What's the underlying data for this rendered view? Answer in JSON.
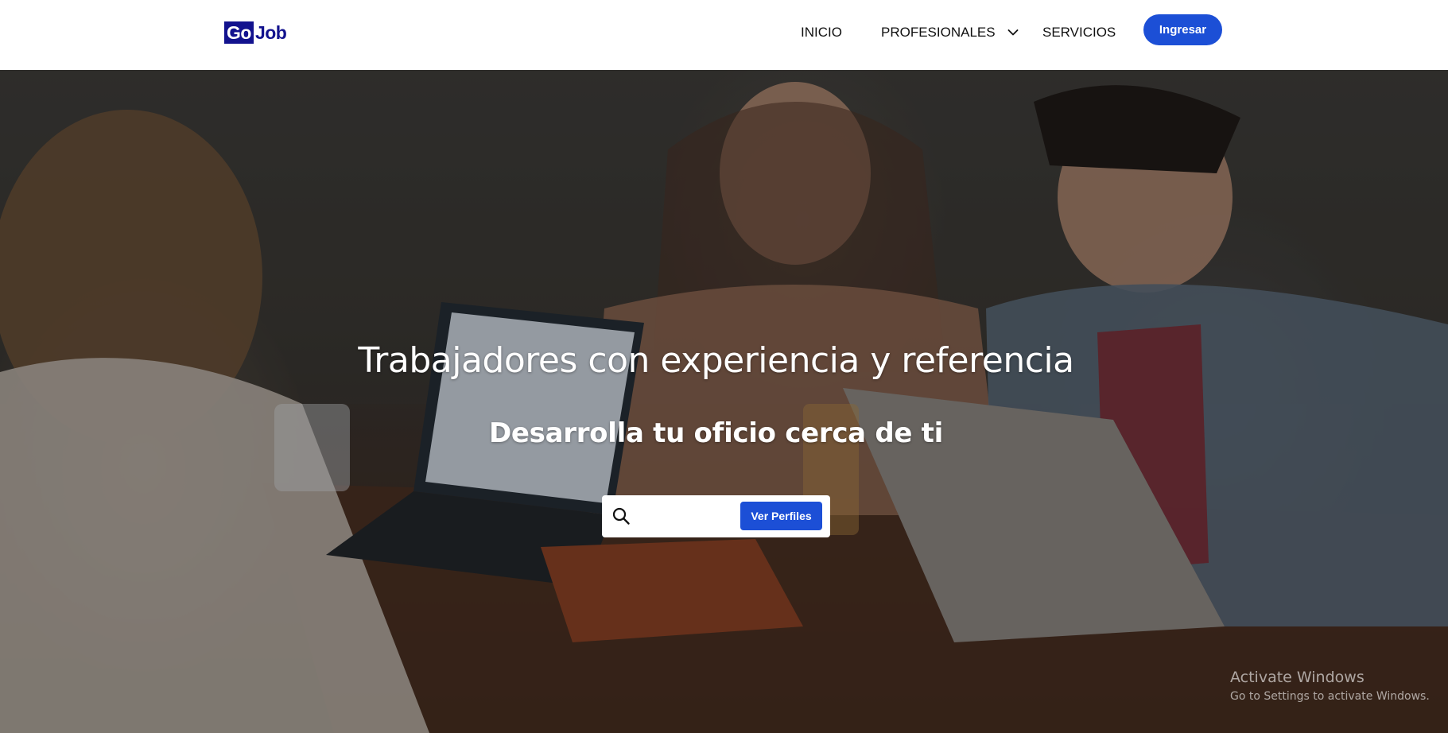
{
  "brand": {
    "logo_part1": "Go",
    "logo_part2": "Job",
    "colors": {
      "primary": "#1c4fd6",
      "logo": "#12128e"
    }
  },
  "nav": {
    "items": [
      {
        "label": "INICIO"
      },
      {
        "label": "PROFESIONALES",
        "icon": "chevron-down-icon"
      },
      {
        "label": "SERVICIOS"
      }
    ],
    "login_label": "Ingresar"
  },
  "hero": {
    "title": "Trabajadores con experiencia y referencia",
    "subtitle": "Desarrolla tu oficio cerca de ti",
    "search": {
      "icon": "search-icon",
      "value": "",
      "placeholder": "",
      "button_label": "Ver Perfiles"
    }
  },
  "watermark": {
    "title": "Activate Windows",
    "subtitle": "Go to Settings to activate Windows."
  }
}
